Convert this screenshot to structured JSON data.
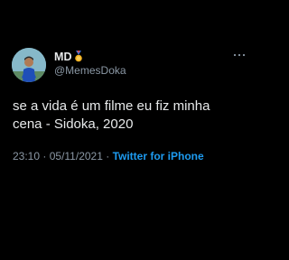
{
  "tweet": {
    "author": {
      "display_name": "MD",
      "badge_icon": "medal-icon",
      "handle": "@MemesDoka"
    },
    "text_lines": [
      "se a vida é um filme eu fiz minha",
      "cena - Sidoka, 2020"
    ],
    "time": "23:10",
    "date": "05/11/2021",
    "separator": "·",
    "source": "Twitter for iPhone",
    "more_icon": "more-options-icon"
  },
  "colors": {
    "background": "#000000",
    "text_primary": "#e7e9ea",
    "text_secondary": "#8b98a5",
    "link": "#1d9bf0",
    "medal_gold": "#f2b01e",
    "medal_ribbon": "#3b6fd6"
  }
}
